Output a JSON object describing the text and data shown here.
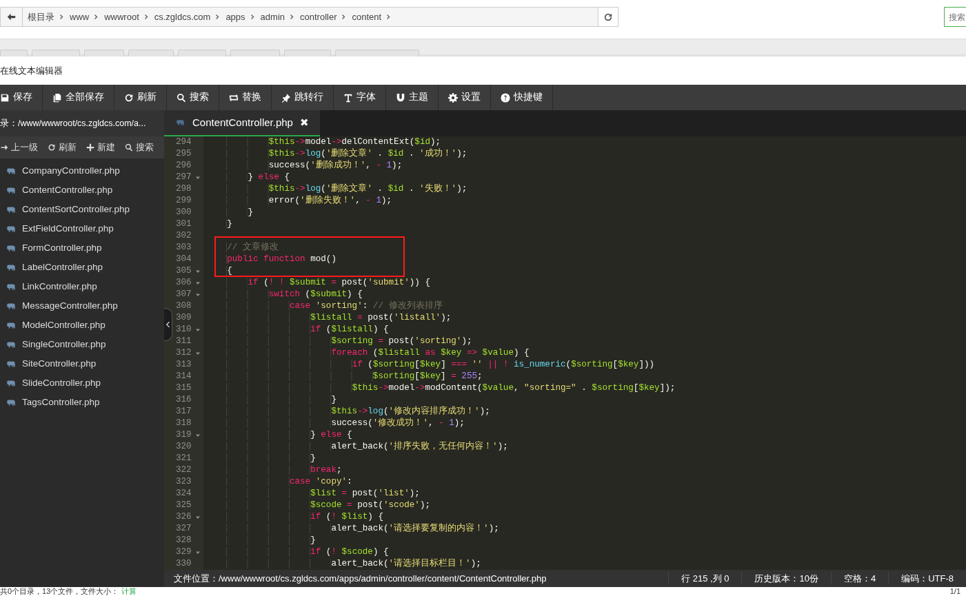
{
  "browser": {
    "breadcrumbs": [
      "根目录",
      "www",
      "wwwroot",
      "cs.zgldcs.com",
      "apps",
      "admin",
      "controller",
      "content"
    ],
    "search": {
      "placeholder": "搜索"
    }
  },
  "editor": {
    "title": "在线文本编辑器",
    "toolbar": [
      {
        "kind": "save",
        "label": "保存"
      },
      {
        "kind": "save-all",
        "label": "全部保存"
      },
      {
        "kind": "refresh",
        "label": "刷新"
      },
      {
        "kind": "search",
        "label": "搜索"
      },
      {
        "kind": "replace",
        "label": "替换"
      },
      {
        "kind": "jump",
        "label": "跳转行"
      },
      {
        "kind": "font",
        "label": "字体"
      },
      {
        "kind": "theme",
        "label": "主题"
      },
      {
        "kind": "settings",
        "label": "设置"
      },
      {
        "kind": "help",
        "label": "快捷键"
      }
    ],
    "sidebar": {
      "path": "录：/www/wwwroot/cs.zgldcs.com/a...",
      "actions": [
        {
          "kind": "up",
          "label": "上一级"
        },
        {
          "kind": "refresh",
          "label": "刷新"
        },
        {
          "kind": "new",
          "label": "新建"
        },
        {
          "kind": "search",
          "label": "搜索"
        }
      ],
      "files": [
        "CompanyController.php",
        "ContentController.php",
        "ContentSortController.php",
        "ExtFieldController.php",
        "FormController.php",
        "LabelController.php",
        "LinkController.php",
        "MessageController.php",
        "ModelController.php",
        "SingleController.php",
        "SiteController.php",
        "SlideController.php",
        "TagsController.php"
      ]
    },
    "tabs": [
      {
        "label": "ContentController.php",
        "close": "✖",
        "selected": true
      }
    ],
    "code": {
      "lines": [
        {
          "number": "294",
          "fold": false,
          "boxed": false,
          "tokens": [
            {
              "kind": "variable",
              "text": "            $this"
            },
            {
              "kind": "operator",
              "text": "->"
            },
            {
              "kind": "plain",
              "text": "model"
            },
            {
              "kind": "operator",
              "text": "->"
            },
            {
              "kind": "plain",
              "text": "delContentExt("
            },
            {
              "kind": "variable",
              "text": "$id"
            },
            {
              "kind": "plain",
              "text": ");"
            }
          ]
        },
        {
          "number": "295",
          "fold": false,
          "boxed": false,
          "tokens": [
            {
              "kind": "variable",
              "text": "            $this"
            },
            {
              "kind": "operator",
              "text": "->"
            },
            {
              "kind": "function",
              "text": "log"
            },
            {
              "kind": "plain",
              "text": "("
            },
            {
              "kind": "string",
              "text": "'删除文章'"
            },
            {
              "kind": "plain",
              "text": " . "
            },
            {
              "kind": "variable",
              "text": "$id"
            },
            {
              "kind": "plain",
              "text": " . "
            },
            {
              "kind": "string",
              "text": "'成功！'"
            },
            {
              "kind": "plain",
              "text": ");"
            }
          ]
        },
        {
          "number": "296",
          "fold": false,
          "boxed": false,
          "tokens": [
            {
              "kind": "plain",
              "text": "            success("
            },
            {
              "kind": "string",
              "text": "'删除成功！'"
            },
            {
              "kind": "plain",
              "text": ", "
            },
            {
              "kind": "operator",
              "text": "- "
            },
            {
              "kind": "number",
              "text": "1"
            },
            {
              "kind": "plain",
              "text": ");"
            }
          ]
        },
        {
          "number": "297",
          "fold": true,
          "boxed": false,
          "tokens": [
            {
              "kind": "plain",
              "text": "        } "
            },
            {
              "kind": "keyword",
              "text": "else"
            },
            {
              "kind": "plain",
              "text": " {"
            }
          ]
        },
        {
          "number": "298",
          "fold": false,
          "boxed": false,
          "tokens": [
            {
              "kind": "variable",
              "text": "            $this"
            },
            {
              "kind": "operator",
              "text": "->"
            },
            {
              "kind": "function",
              "text": "log"
            },
            {
              "kind": "plain",
              "text": "("
            },
            {
              "kind": "string",
              "text": "'删除文章'"
            },
            {
              "kind": "plain",
              "text": " . "
            },
            {
              "kind": "variable",
              "text": "$id"
            },
            {
              "kind": "plain",
              "text": " . "
            },
            {
              "kind": "string",
              "text": "'失败！'"
            },
            {
              "kind": "plain",
              "text": ");"
            }
          ]
        },
        {
          "number": "299",
          "fold": false,
          "boxed": false,
          "tokens": [
            {
              "kind": "plain",
              "text": "            error("
            },
            {
              "kind": "string",
              "text": "'删除失败！'"
            },
            {
              "kind": "plain",
              "text": ", "
            },
            {
              "kind": "operator",
              "text": "- "
            },
            {
              "kind": "number",
              "text": "1"
            },
            {
              "kind": "plain",
              "text": ");"
            }
          ]
        },
        {
          "number": "300",
          "fold": false,
          "boxed": false,
          "tokens": [
            {
              "kind": "plain",
              "text": "        }"
            }
          ]
        },
        {
          "number": "301",
          "fold": false,
          "boxed": false,
          "tokens": [
            {
              "kind": "plain",
              "text": "    }"
            }
          ]
        },
        {
          "number": "302",
          "fold": false,
          "boxed": false
        },
        {
          "number": "303",
          "fold": false,
          "boxed": true,
          "tokens": [
            {
              "kind": "comment",
              "text": "    // 文章修改"
            }
          ]
        },
        {
          "number": "304",
          "fold": false,
          "boxed": true,
          "tokens": [
            {
              "kind": "keyword",
              "text": "    public function"
            },
            {
              "kind": "plain",
              "text": " mod()"
            }
          ]
        },
        {
          "number": "305",
          "fold": true,
          "boxed": true,
          "tokens": [
            {
              "kind": "plain",
              "text": "    {"
            }
          ]
        },
        {
          "number": "306",
          "fold": true,
          "boxed": false,
          "tokens": [
            {
              "kind": "keyword",
              "text": "        if"
            },
            {
              "kind": "plain",
              "text": " ("
            },
            {
              "kind": "operator",
              "text": "! ! "
            },
            {
              "kind": "variable",
              "text": "$submit"
            },
            {
              "kind": "operator",
              "text": " = "
            },
            {
              "kind": "plain",
              "text": "post("
            },
            {
              "kind": "string",
              "text": "'submit'"
            },
            {
              "kind": "plain",
              "text": ")) {"
            }
          ]
        },
        {
          "number": "307",
          "fold": true,
          "boxed": false,
          "tokens": [
            {
              "kind": "keyword",
              "text": "            switch"
            },
            {
              "kind": "plain",
              "text": " ("
            },
            {
              "kind": "variable",
              "text": "$submit"
            },
            {
              "kind": "plain",
              "text": ") {"
            }
          ]
        },
        {
          "number": "308",
          "fold": false,
          "boxed": false,
          "tokens": [
            {
              "kind": "keyword",
              "text": "                case"
            },
            {
              "kind": "string",
              "text": " 'sorting'"
            },
            {
              "kind": "plain",
              "text": ": "
            },
            {
              "kind": "comment",
              "text": "// 修改列表排序"
            }
          ]
        },
        {
          "number": "309",
          "fold": false,
          "boxed": false,
          "tokens": [
            {
              "kind": "variable",
              "text": "                    $listall"
            },
            {
              "kind": "operator",
              "text": " = "
            },
            {
              "kind": "plain",
              "text": "post("
            },
            {
              "kind": "string",
              "text": "'listall'"
            },
            {
              "kind": "plain",
              "text": ");"
            }
          ]
        },
        {
          "number": "310",
          "fold": true,
          "boxed": false,
          "tokens": [
            {
              "kind": "keyword",
              "text": "                    if"
            },
            {
              "kind": "plain",
              "text": " ("
            },
            {
              "kind": "variable",
              "text": "$listall"
            },
            {
              "kind": "plain",
              "text": ") {"
            }
          ]
        },
        {
          "number": "311",
          "fold": false,
          "boxed": false,
          "tokens": [
            {
              "kind": "variable",
              "text": "                        $sorting"
            },
            {
              "kind": "operator",
              "text": " = "
            },
            {
              "kind": "plain",
              "text": "post("
            },
            {
              "kind": "string",
              "text": "'sorting'"
            },
            {
              "kind": "plain",
              "text": ");"
            }
          ]
        },
        {
          "number": "312",
          "fold": true,
          "boxed": false,
          "tokens": [
            {
              "kind": "keyword",
              "text": "                        foreach"
            },
            {
              "kind": "plain",
              "text": " ("
            },
            {
              "kind": "variable",
              "text": "$listall"
            },
            {
              "kind": "keyword",
              "text": " as "
            },
            {
              "kind": "variable",
              "text": "$key"
            },
            {
              "kind": "operator",
              "text": " => "
            },
            {
              "kind": "variable",
              "text": "$value"
            },
            {
              "kind": "plain",
              "text": ") {"
            }
          ]
        },
        {
          "number": "313",
          "fold": false,
          "boxed": false,
          "tokens": [
            {
              "kind": "keyword",
              "text": "                            if"
            },
            {
              "kind": "plain",
              "text": " ("
            },
            {
              "kind": "variable",
              "text": "$sorting"
            },
            {
              "kind": "plain",
              "text": "["
            },
            {
              "kind": "variable",
              "text": "$key"
            },
            {
              "kind": "plain",
              "text": "] "
            },
            {
              "kind": "operator",
              "text": "=== "
            },
            {
              "kind": "string",
              "text": "''"
            },
            {
              "kind": "operator",
              "text": " || ! "
            },
            {
              "kind": "function",
              "text": "is_numeric"
            },
            {
              "kind": "plain",
              "text": "("
            },
            {
              "kind": "variable",
              "text": "$sorting"
            },
            {
              "kind": "plain",
              "text": "["
            },
            {
              "kind": "variable",
              "text": "$key"
            },
            {
              "kind": "plain",
              "text": "]))"
            }
          ]
        },
        {
          "number": "314",
          "fold": false,
          "boxed": false,
          "tokens": [
            {
              "kind": "variable",
              "text": "                                $sorting"
            },
            {
              "kind": "plain",
              "text": "["
            },
            {
              "kind": "variable",
              "text": "$key"
            },
            {
              "kind": "plain",
              "text": "] "
            },
            {
              "kind": "operator",
              "text": "= "
            },
            {
              "kind": "number",
              "text": "255"
            },
            {
              "kind": "plain",
              "text": ";"
            }
          ]
        },
        {
          "number": "315",
          "fold": false,
          "boxed": false,
          "tokens": [
            {
              "kind": "variable",
              "text": "                            $this"
            },
            {
              "kind": "operator",
              "text": "->"
            },
            {
              "kind": "plain",
              "text": "model"
            },
            {
              "kind": "operator",
              "text": "->"
            },
            {
              "kind": "plain",
              "text": "modContent("
            },
            {
              "kind": "variable",
              "text": "$value"
            },
            {
              "kind": "plain",
              "text": ", "
            },
            {
              "kind": "string",
              "text": "\"sorting=\""
            },
            {
              "kind": "plain",
              "text": " . "
            },
            {
              "kind": "variable",
              "text": "$sorting"
            },
            {
              "kind": "plain",
              "text": "["
            },
            {
              "kind": "variable",
              "text": "$key"
            },
            {
              "kind": "plain",
              "text": "]);"
            }
          ]
        },
        {
          "number": "316",
          "fold": false,
          "boxed": false,
          "tokens": [
            {
              "kind": "plain",
              "text": "                        }"
            }
          ]
        },
        {
          "number": "317",
          "fold": false,
          "boxed": false,
          "tokens": [
            {
              "kind": "variable",
              "text": "                        $this"
            },
            {
              "kind": "operator",
              "text": "->"
            },
            {
              "kind": "function",
              "text": "log"
            },
            {
              "kind": "plain",
              "text": "("
            },
            {
              "kind": "string",
              "text": "'修改内容排序成功！'"
            },
            {
              "kind": "plain",
              "text": ");"
            }
          ]
        },
        {
          "number": "318",
          "fold": false,
          "boxed": false,
          "tokens": [
            {
              "kind": "plain",
              "text": "                        success("
            },
            {
              "kind": "string",
              "text": "'修改成功！'"
            },
            {
              "kind": "plain",
              "text": ", "
            },
            {
              "kind": "operator",
              "text": "- "
            },
            {
              "kind": "number",
              "text": "1"
            },
            {
              "kind": "plain",
              "text": ");"
            }
          ]
        },
        {
          "number": "319",
          "fold": true,
          "boxed": false,
          "tokens": [
            {
              "kind": "plain",
              "text": "                    } "
            },
            {
              "kind": "keyword",
              "text": "else"
            },
            {
              "kind": "plain",
              "text": " {"
            }
          ]
        },
        {
          "number": "320",
          "fold": false,
          "boxed": false,
          "tokens": [
            {
              "kind": "plain",
              "text": "                        alert_back("
            },
            {
              "kind": "string",
              "text": "'排序失败，无任何内容！'"
            },
            {
              "kind": "plain",
              "text": ");"
            }
          ]
        },
        {
          "number": "321",
          "fold": false,
          "boxed": false,
          "tokens": [
            {
              "kind": "plain",
              "text": "                    }"
            }
          ]
        },
        {
          "number": "322",
          "fold": false,
          "boxed": false,
          "tokens": [
            {
              "kind": "keyword",
              "text": "                    break"
            },
            {
              "kind": "plain",
              "text": ";"
            }
          ]
        },
        {
          "number": "323",
          "fold": false,
          "boxed": false,
          "tokens": [
            {
              "kind": "keyword",
              "text": "                case"
            },
            {
              "kind": "string",
              "text": " 'copy'"
            },
            {
              "kind": "plain",
              "text": ":"
            }
          ]
        },
        {
          "number": "324",
          "fold": false,
          "boxed": false,
          "tokens": [
            {
              "kind": "variable",
              "text": "                    $list"
            },
            {
              "kind": "operator",
              "text": " = "
            },
            {
              "kind": "plain",
              "text": "post("
            },
            {
              "kind": "string",
              "text": "'list'"
            },
            {
              "kind": "plain",
              "text": ");"
            }
          ]
        },
        {
          "number": "325",
          "fold": false,
          "boxed": false,
          "tokens": [
            {
              "kind": "variable",
              "text": "                    $scode"
            },
            {
              "kind": "operator",
              "text": " = "
            },
            {
              "kind": "plain",
              "text": "post("
            },
            {
              "kind": "string",
              "text": "'scode'"
            },
            {
              "kind": "plain",
              "text": ");"
            }
          ]
        },
        {
          "number": "326",
          "fold": true,
          "boxed": false,
          "tokens": [
            {
              "kind": "keyword",
              "text": "                    if"
            },
            {
              "kind": "plain",
              "text": " ("
            },
            {
              "kind": "operator",
              "text": "! "
            },
            {
              "kind": "variable",
              "text": "$list"
            },
            {
              "kind": "plain",
              "text": ") {"
            }
          ]
        },
        {
          "number": "327",
          "fold": false,
          "boxed": false,
          "tokens": [
            {
              "kind": "plain",
              "text": "                        alert_back("
            },
            {
              "kind": "string",
              "text": "'请选择要复制的内容！'"
            },
            {
              "kind": "plain",
              "text": ");"
            }
          ]
        },
        {
          "number": "328",
          "fold": false,
          "boxed": false,
          "tokens": [
            {
              "kind": "plain",
              "text": "                    }"
            }
          ]
        },
        {
          "number": "329",
          "fold": true,
          "boxed": false,
          "tokens": [
            {
              "kind": "keyword",
              "text": "                    if"
            },
            {
              "kind": "plain",
              "text": " ("
            },
            {
              "kind": "operator",
              "text": "! "
            },
            {
              "kind": "variable",
              "text": "$scode"
            },
            {
              "kind": "plain",
              "text": ") {"
            }
          ]
        },
        {
          "number": "330",
          "fold": false,
          "boxed": false,
          "tokens": [
            {
              "kind": "plain",
              "text": "                        alert_back("
            },
            {
              "kind": "string",
              "text": "'请选择目标栏目！'"
            },
            {
              "kind": "plain",
              "text": ");"
            }
          ]
        }
      ]
    },
    "status_bar": {
      "file_location": "文件位置：/www/wwwroot/cs.zgldcs.com/apps/admin/controller/content/ContentController.php",
      "cursor": "行 215 ,列 0",
      "history": "历史版本：10份",
      "indent": "空格：4",
      "encoding": "编码：UTF-8"
    }
  },
  "page_footer": {
    "summary": "共0个目录，13个文件，文件大小：",
    "link": "计算",
    "pager": "1/1"
  }
}
